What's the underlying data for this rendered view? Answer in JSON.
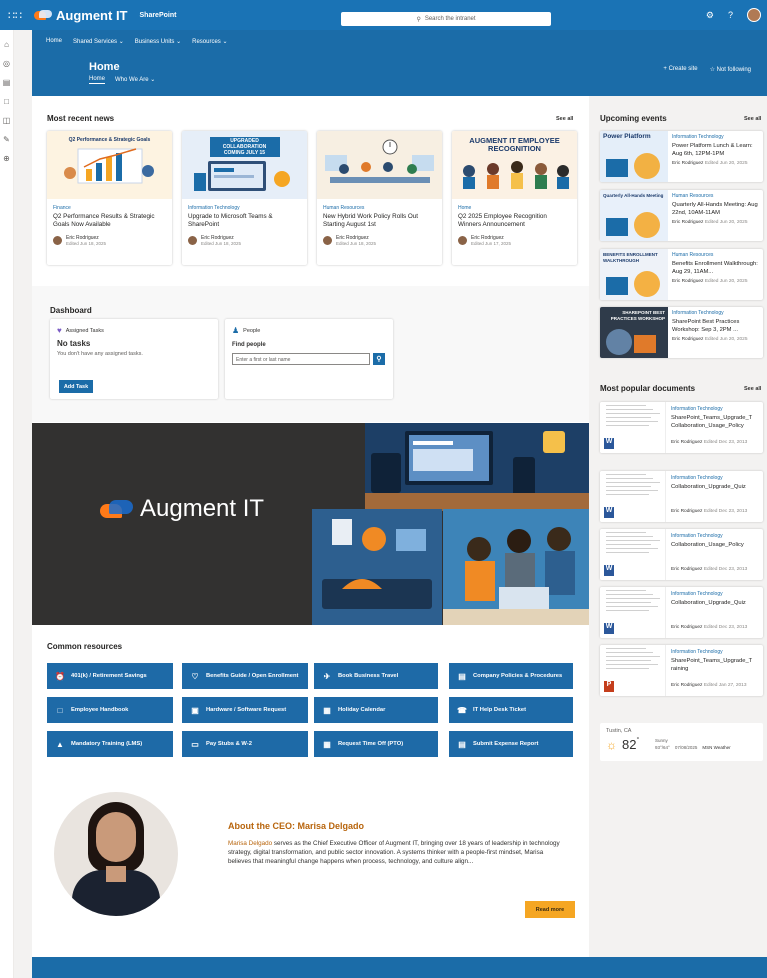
{
  "suite": {
    "brand": "Augment IT",
    "product": "SharePoint",
    "search_placeholder": "Search the intranet"
  },
  "topnav": [
    "Home",
    "Shared Services ⌄",
    "Business Units ⌄",
    "Resources ⌄"
  ],
  "site": {
    "title": "Home",
    "subnav": [
      "Home",
      "Who We Are ⌄"
    ],
    "create_site": "+ Create site",
    "following": "☆ Not following"
  },
  "news": {
    "heading": "Most recent news",
    "see_all": "See all",
    "items": [
      {
        "image_title": "Q2 Performance & Strategic Goals",
        "category": "Finance",
        "title": "Q2 Performance Results & Strategic Goals Now Available",
        "author": "Eric Rodriguez",
        "date": "Edited Jun 18, 2025",
        "bg": "#fdf3e1"
      },
      {
        "image_title": "UPGRADED COLLABORATION COMING JULY 15",
        "category": "Information Technology",
        "title": "Upgrade to Microsoft Teams & SharePoint",
        "author": "Eric Rodriguez",
        "date": "Edited Jun 18, 2025",
        "bg": "#e6eef8"
      },
      {
        "image_title": "",
        "category": "Human Resources",
        "title": "New Hybrid Work Policy Rolls Out Starting August 1st",
        "author": "Eric Rodriguez",
        "date": "Edited Jun 18, 2025",
        "bg": "#f7efe2"
      },
      {
        "image_title": "AUGMENT IT EMPLOYEE RECOGNITION",
        "category": "Home",
        "title": "Q2 2025 Employee Recognition Winners Announcement",
        "author": "Eric Rodriguez",
        "date": "Edited Jun 17, 2025",
        "bg": "#fbf1e4"
      }
    ]
  },
  "dashboard": {
    "heading": "Dashboard",
    "tasks": {
      "label": "Assigned Tasks",
      "title": "No tasks",
      "text": "You don't have any assigned tasks.",
      "button": "Add Task"
    },
    "people": {
      "label": "People",
      "find": "Find people",
      "placeholder": "Enter a first or last name"
    }
  },
  "hero": {
    "brand": "Augment IT"
  },
  "resources": {
    "heading": "Common resources",
    "items": [
      {
        "label": "401(k) / Retirement Savings",
        "icon": "⏰"
      },
      {
        "label": "Benefits Guide / Open Enrollment",
        "icon": "♡"
      },
      {
        "label": "Book Business Travel",
        "icon": "✈"
      },
      {
        "label": "Company Policies & Procedures",
        "icon": "▤"
      },
      {
        "label": "Employee Handbook",
        "icon": "□"
      },
      {
        "label": "Hardware / Software Request",
        "icon": "▣"
      },
      {
        "label": "Holiday Calendar",
        "icon": "▦"
      },
      {
        "label": "IT Help Desk Ticket",
        "icon": "☎"
      },
      {
        "label": "Mandatory Training (LMS)",
        "icon": "▲"
      },
      {
        "label": "Pay Stubs & W-2",
        "icon": "▭"
      },
      {
        "label": "Request Time Off (PTO)",
        "icon": "▦"
      },
      {
        "label": "Submit Expense Report",
        "icon": "▤"
      }
    ]
  },
  "ceo": {
    "heading": "About the CEO: Marisa Delgado",
    "name_link": "Marisa Delgado",
    "body": " serves as the Chief Executive Officer of Augment IT, bringing over 18 years of leadership in technology strategy, digital transformation, and public sector innovation. A systems thinker with a people-first mindset, Marisa believes that meaningful change happens when process, technology, and culture align...",
    "button": "Read more"
  },
  "events": {
    "heading": "Upcoming events",
    "see_all": "See all",
    "items": [
      {
        "image_title": "Power Platform",
        "category": "Information Technology",
        "title": "Power Platform Lunch & Learn: Aug 6th, 12PM-1PM",
        "author": "Eric Rodriguez",
        "date": "Edited Jun 20, 2025",
        "bg": "#e4eef9"
      },
      {
        "image_title": "Quarterly All-Hands Meeting",
        "category": "Human Resources",
        "title": "Quarterly All-Hands Meeting: Aug 22nd, 10AM-11AM",
        "author": "Eric Rodriguez",
        "date": "Edited Jun 20, 2025",
        "bg": "#e8f0fa"
      },
      {
        "image_title": "BENEFITS ENROLLMENT WALKTHROUGH",
        "category": "Human Resources",
        "title": "Benefits Enrollment Walkthrough: Aug 29, 11AM...",
        "author": "Eric Rodriguez",
        "date": "Edited Jun 20, 2025",
        "bg": "#eef2f8"
      },
      {
        "image_title": "SHAREPOINT BEST PRACTICES WORKSHOP",
        "category": "Information Technology",
        "title": "SharePoint Best Practices Workshop: Sep 3, 2PM ...",
        "author": "Eric Rodriguez",
        "date": "Edited Jun 20, 2025",
        "bg": "#2f3b4a"
      }
    ]
  },
  "documents": {
    "heading": "Most popular documents",
    "see_all": "See all",
    "items": [
      {
        "category": "Information Technology",
        "title": "SharePoint_Teams_Upgrade_T Collaboration_Usage_Policy",
        "author": "Eric Rodriguez",
        "date": "Edited Dec 23, 2013",
        "badge": "W",
        "badge_color": "#2b579a"
      },
      {
        "category": "Information Technology",
        "title": "Collaboration_Upgrade_Quiz",
        "author": "Eric Rodriguez",
        "date": "Edited Dec 23, 2013",
        "badge": "W",
        "badge_color": "#2b579a"
      },
      {
        "category": "Information Technology",
        "title": "Collaboration_Usage_Policy",
        "author": "Eric Rodriguez",
        "date": "Edited Dec 23, 2013",
        "badge": "W",
        "badge_color": "#2b579a"
      },
      {
        "category": "Information Technology",
        "title": "Collaboration_Upgrade_Quiz",
        "author": "Eric Rodriguez",
        "date": "Edited Dec 23, 2013",
        "badge": "W",
        "badge_color": "#2b579a"
      },
      {
        "category": "Information Technology",
        "title": "SharePoint_Teams_Upgrade_T raining",
        "author": "Eric Rodriguez",
        "date": "Edited Jan 27, 2013",
        "badge": "P",
        "badge_color": "#c43e1c"
      }
    ]
  },
  "weather": {
    "location": "Tustin, CA",
    "temp": "82",
    "unit": "°",
    "condition": "Sunny",
    "range": "93°/64°",
    "date": "07/08/2025",
    "source": "MSN Weather"
  },
  "colors": {
    "brand": "#1b6ca8",
    "accent": "#f5a623",
    "ceo_heading": "#b8650d"
  }
}
